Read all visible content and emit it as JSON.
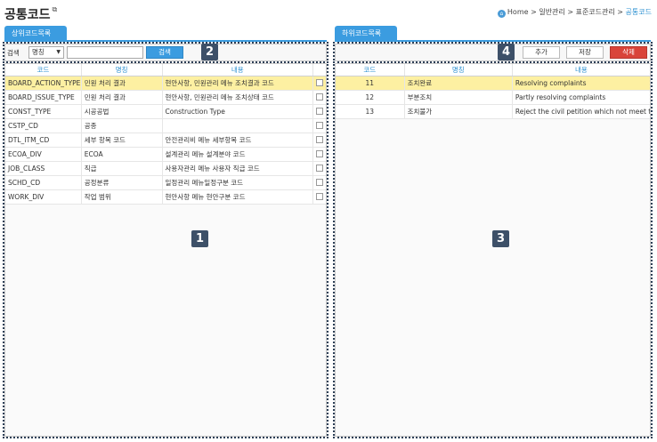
{
  "page": {
    "title": "공통코드",
    "breadcrumb": [
      "Home",
      "일반관리",
      "표준코드관리",
      "공통코드"
    ]
  },
  "left": {
    "tab": "상위코드목록",
    "search": {
      "label": "검색",
      "select_value": "명칭",
      "input_value": "",
      "button": "검색"
    },
    "columns": [
      "코드",
      "명칭",
      "내용"
    ],
    "rows": [
      {
        "code": "BOARD_ACTION_TYPE",
        "name": "민원 처리 결과",
        "desc": "현안사항, 민원관리 메뉴 조치결과 코드",
        "selected": true
      },
      {
        "code": "BOARD_ISSUE_TYPE",
        "name": "민원 처리 결과",
        "desc": "현안사항, 민원관리 메뉴 조치상태 코드",
        "selected": false
      },
      {
        "code": "CONST_TYPE",
        "name": "시공공법",
        "desc": "Construction Type",
        "selected": false
      },
      {
        "code": "CSTP_CD",
        "name": "공종",
        "desc": "",
        "selected": false
      },
      {
        "code": "DTL_ITM_CD",
        "name": "세부 항목 코드",
        "desc": "안전관리비 메뉴 세부항목 코드",
        "selected": false
      },
      {
        "code": "ECOA_DIV",
        "name": "ECOA",
        "desc": "설계관리 메뉴 설계분야 코드",
        "selected": false
      },
      {
        "code": "JOB_CLASS",
        "name": "직급",
        "desc": "사용자관리 메뉴 사용자 직급 코드",
        "selected": false
      },
      {
        "code": "SCHD_CD",
        "name": "공정분류",
        "desc": "일정관리 메뉴일정구분 코드",
        "selected": false
      },
      {
        "code": "WORK_DIV",
        "name": "작업 범위",
        "desc": "현안사항 메뉴 현안구분 코드",
        "selected": false
      }
    ]
  },
  "right": {
    "tab": "하위코드목록",
    "buttons": {
      "add": "추가",
      "save": "저장",
      "delete": "삭제"
    },
    "columns": [
      "코드",
      "명칭",
      "내용"
    ],
    "rows": [
      {
        "code": "11",
        "name": "조치완료",
        "desc": "Resolving complaints",
        "selected": true
      },
      {
        "code": "12",
        "name": "부분조치",
        "desc": "Partly resolving complaints",
        "selected": false
      },
      {
        "code": "13",
        "name": "조치불가",
        "desc": "Reject the civil petition which not meet the re",
        "selected": false
      }
    ]
  },
  "badges": [
    "1",
    "2",
    "3",
    "4"
  ],
  "colors": {
    "accent": "#3b9ce0",
    "selected_row": "#fdf0a2",
    "delete": "#d9443a",
    "badge": "#3d5068"
  }
}
